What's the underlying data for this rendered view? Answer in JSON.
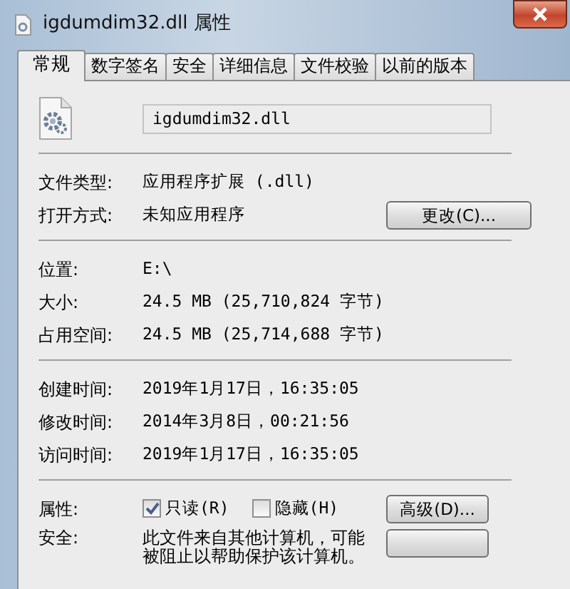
{
  "window": {
    "title": "igdumdim32.dll 属性"
  },
  "tabs": [
    {
      "label": "常规",
      "selected": true
    },
    {
      "label": "数字签名",
      "selected": false
    },
    {
      "label": "安全",
      "selected": false
    },
    {
      "label": "详细信息",
      "selected": false
    },
    {
      "label": "文件校验",
      "selected": false
    },
    {
      "label": "以前的版本",
      "selected": false
    }
  ],
  "file_name": "igdumdim32.dll",
  "groups": [
    {
      "rows": [
        {
          "kind": "field",
          "label": "文件类型:",
          "value": "应用程序扩展 (.dll)"
        },
        {
          "kind": "field",
          "label": "打开方式:",
          "value": "未知应用程序",
          "button": "更改(C)..."
        }
      ]
    },
    {
      "rows": [
        {
          "kind": "field",
          "label": "位置:",
          "value": "E:\\"
        },
        {
          "kind": "field",
          "label": "大小:",
          "value": "24.5 MB (25,710,824 字节)"
        },
        {
          "kind": "field",
          "label": "占用空间:",
          "value": "24.5 MB (25,714,688 字节)"
        }
      ]
    },
    {
      "rows": [
        {
          "kind": "field",
          "label": "创建时间:",
          "value": "2019年1月17日，16:35:05"
        },
        {
          "kind": "field",
          "label": "修改时间:",
          "value": "2014年3月8日，00:21:56"
        },
        {
          "kind": "field",
          "label": "访问时间:",
          "value": "2019年1月17日，16:35:05"
        }
      ]
    },
    {
      "rows": [
        {
          "kind": "check",
          "label": "属性:",
          "checkboxes": [
            {
              "label": "只读(R)",
              "checked": true
            },
            {
              "label": "隐藏(H)",
              "checked": false
            }
          ],
          "button": "高级(D)..."
        },
        {
          "kind": "note",
          "label": "安全:",
          "text": "此文件来自其他计算机，可能被阻止以帮助保护该计算机。"
        }
      ]
    }
  ]
}
